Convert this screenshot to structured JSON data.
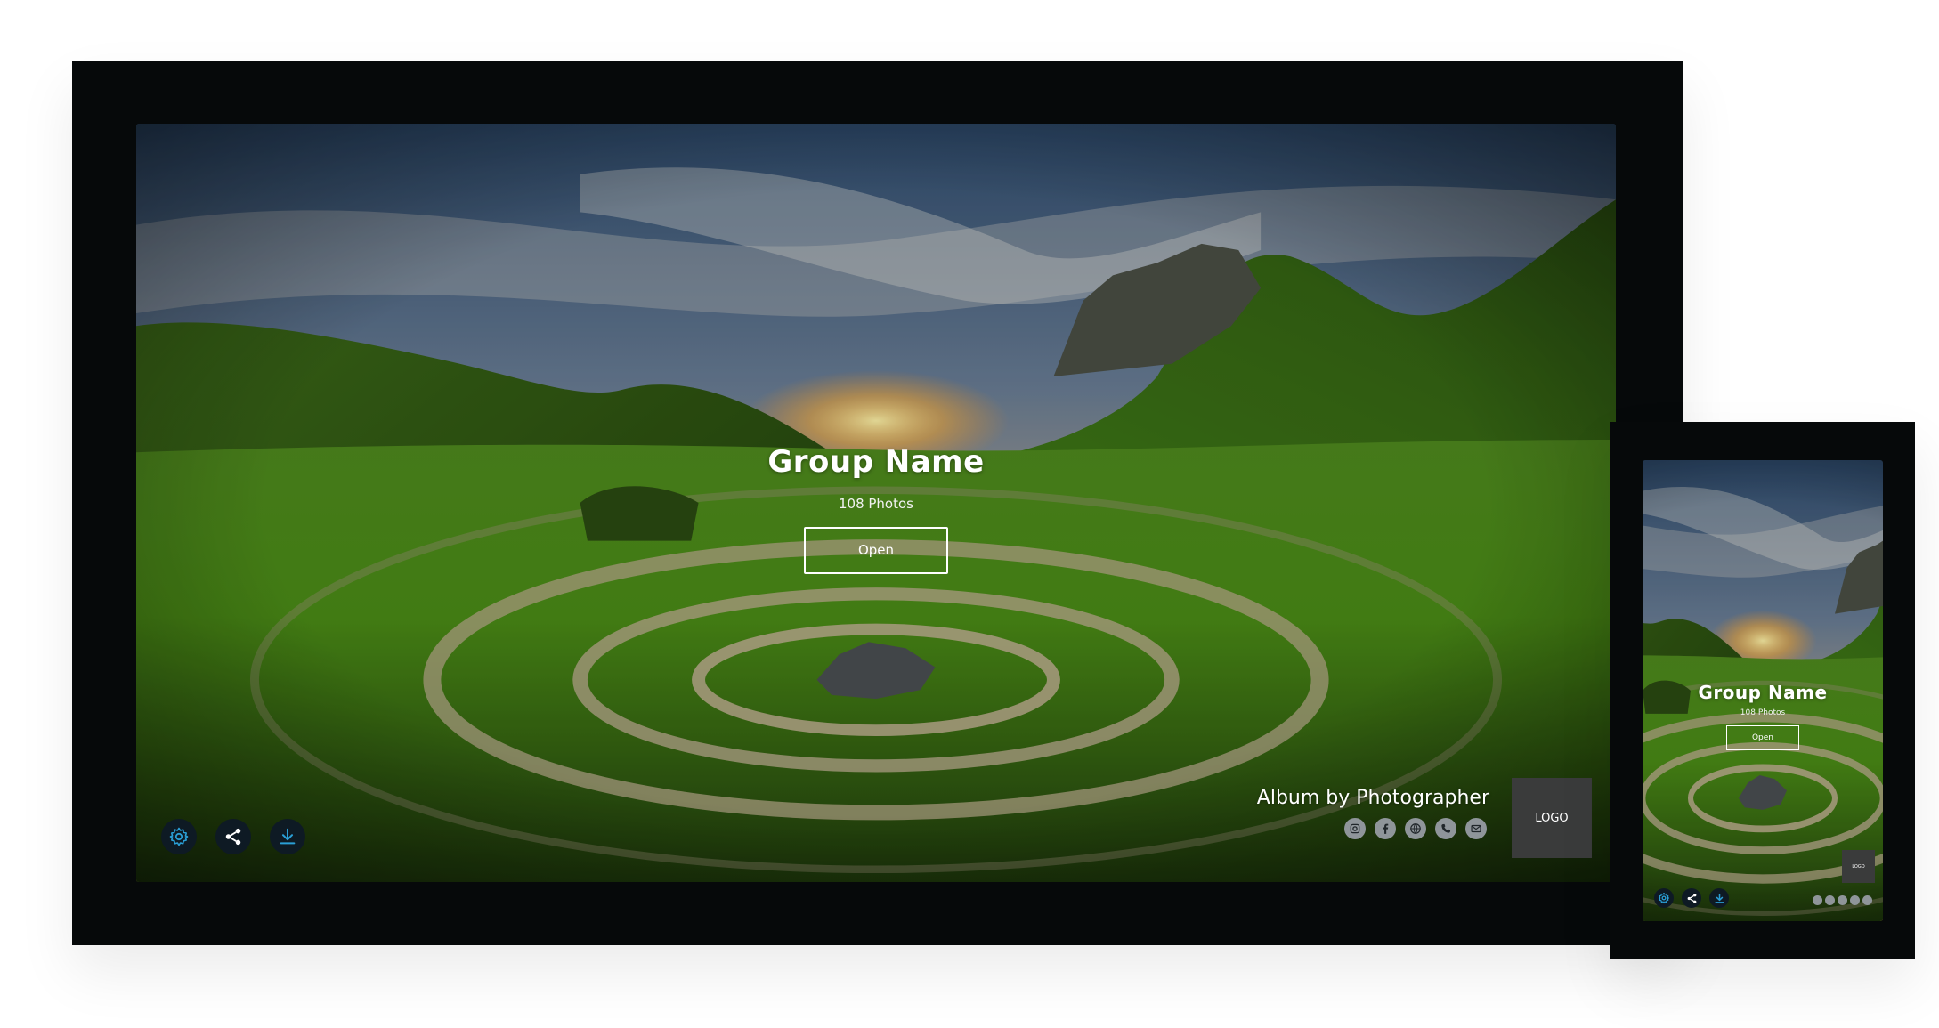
{
  "album": {
    "title": "Group Name",
    "photo_count": "108 Photos",
    "open_label": "Open",
    "credit": "Album by Photographer",
    "logo_label": "LOGO"
  },
  "controls": {
    "icons": [
      "gear-icon",
      "share-icon",
      "download-icon"
    ]
  },
  "social": {
    "icons": [
      "instagram-icon",
      "facebook-icon",
      "globe-icon",
      "phone-icon",
      "mail-icon"
    ]
  },
  "colors": {
    "frame": "#06090a",
    "button_bg": "#0e1a24",
    "button_icon": "#2a9fd6",
    "logo_box": "#3a3b3b",
    "social_icon": "#8f959a"
  }
}
